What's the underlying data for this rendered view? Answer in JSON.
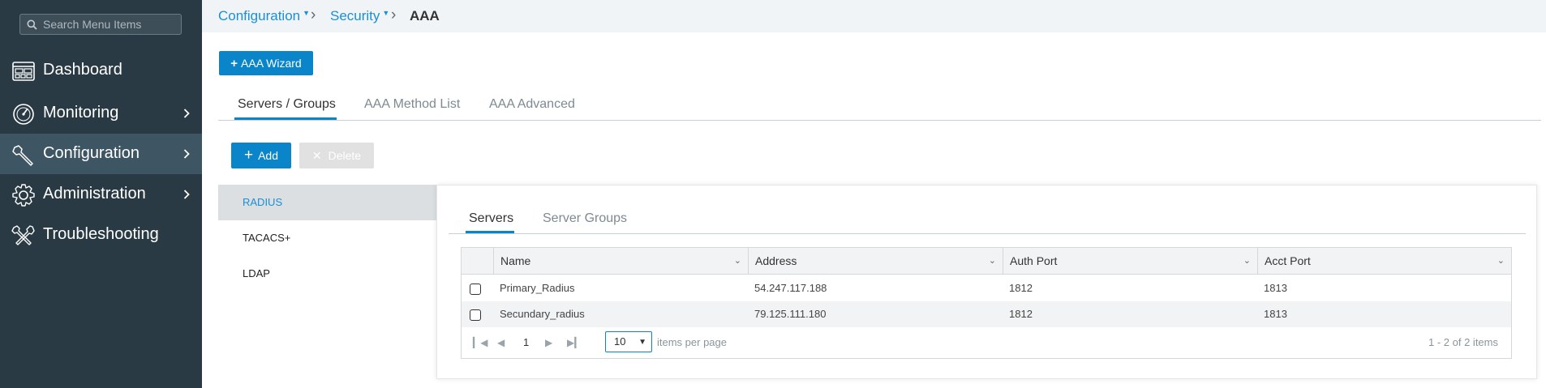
{
  "sidebar": {
    "search_placeholder": "Search Menu Items",
    "items": [
      {
        "label": "Dashboard",
        "icon": "dashboard-icon"
      },
      {
        "label": "Monitoring",
        "icon": "monitoring-icon"
      },
      {
        "label": "Configuration",
        "icon": "wrench-icon",
        "active": true
      },
      {
        "label": "Administration",
        "icon": "gear-icon"
      },
      {
        "label": "Troubleshooting",
        "icon": "tools-icon"
      }
    ]
  },
  "breadcrumb": {
    "items": [
      "Configuration",
      "Security"
    ],
    "current": "AAA"
  },
  "toolbar": {
    "wizard_label": "AAA Wizard",
    "add_label": "Add",
    "delete_label": "Delete"
  },
  "tabs": [
    "Servers / Groups",
    "AAA Method List",
    "AAA Advanced"
  ],
  "server_types": [
    "RADIUS",
    "TACACS+",
    "LDAP"
  ],
  "subtabs": [
    "Servers",
    "Server Groups"
  ],
  "table": {
    "columns": [
      "Name",
      "Address",
      "Auth Port",
      "Acct Port"
    ],
    "rows": [
      {
        "name": "Primary_Radius",
        "address": "54.247.117.188",
        "auth_port": "1812",
        "acct_port": "1813"
      },
      {
        "name": "Secundary_radius",
        "address": "79.125.111.180",
        "auth_port": "1812",
        "acct_port": "1813"
      }
    ]
  },
  "pager": {
    "page": "1",
    "page_size": "10",
    "per_page_label": "items per page",
    "count_label": "1 - 2 of 2 items"
  },
  "colors": {
    "accent": "#0a85c9",
    "sidebar_bg": "#293a44",
    "sidebar_active": "#3e5563"
  }
}
